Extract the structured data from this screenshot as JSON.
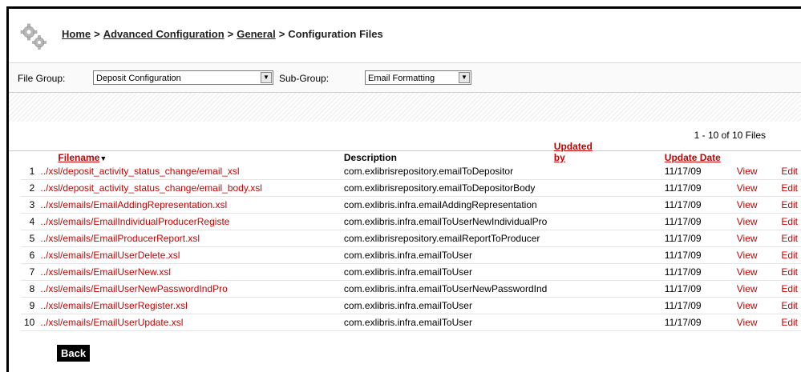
{
  "breadcrumb": {
    "home": "Home",
    "advanced": "Advanced Configuration",
    "general": "General",
    "current": "Configuration Files",
    "separator": ">"
  },
  "filters": {
    "file_group_label": "File Group:",
    "file_group_value": "Deposit Configuration",
    "sub_group_label": "Sub-Group:",
    "sub_group_value": "Email Formatting"
  },
  "results_count": "1 - 10 of 10 Files",
  "table": {
    "columns": {
      "filename": "Filename",
      "description": "Description",
      "updated_by": "Updated by",
      "update_date": "Update Date"
    },
    "rows": [
      {
        "num": "1",
        "filename": "../xsl/deposit_activity_status_change/email_xsl",
        "description": "com.exlibrisrepository.emailToDepositor",
        "date": "11/17/09",
        "view": "View",
        "edit": "Edit"
      },
      {
        "num": "2",
        "filename": "../xsl/deposit_activity_status_change/email_body.xsl",
        "description": "com.exlibrisrepository.emailToDepositorBody",
        "date": "11/17/09",
        "view": "View",
        "edit": "Edit"
      },
      {
        "num": "3",
        "filename": "../xsl/emails/EmailAddingRepresentation.xsl",
        "description": "com.exlibris.infra.emailAddingRepresentation",
        "date": "11/17/09",
        "view": "View",
        "edit": "Edit"
      },
      {
        "num": "4",
        "filename": "../xsl/emails/EmailIndividualProducerRegiste",
        "description": "com.exlibris.infra.emailToUserNewIndividualPro",
        "date": "11/17/09",
        "view": "View",
        "edit": "Edit"
      },
      {
        "num": "5",
        "filename": "../xsl/emails/EmailProducerReport.xsl",
        "description": "com.exlibrisrepository.emailReportToProducer",
        "date": "11/17/09",
        "view": "View",
        "edit": "Edit"
      },
      {
        "num": "6",
        "filename": "../xsl/emails/EmailUserDelete.xsl",
        "description": "com.exlibris.infra.emailToUser",
        "date": "11/17/09",
        "view": "View",
        "edit": "Edit"
      },
      {
        "num": "7",
        "filename": "../xsl/emails/EmailUserNew.xsl",
        "description": "com.exlibris.infra.emailToUser",
        "date": "11/17/09",
        "view": "View",
        "edit": "Edit"
      },
      {
        "num": "8",
        "filename": "../xsl/emails/EmailUserNewPasswordIndPro",
        "description": "com.exlibris.infra.emailToUserNewPasswordInd",
        "date": "11/17/09",
        "view": "View",
        "edit": "Edit"
      },
      {
        "num": "9",
        "filename": "../xsl/emails/EmailUserRegister.xsl",
        "description": "com.exlibris.infra.emailToUser",
        "date": "11/17/09",
        "view": "View",
        "edit": "Edit"
      },
      {
        "num": "10",
        "filename": "../xsl/emails/EmailUserUpdate.xsl",
        "description": "com.exlibris.infra.emailToUser",
        "date": "11/17/09",
        "view": "View",
        "edit": "Edit"
      }
    ]
  },
  "back_label": "Back",
  "icons": {
    "header": "gears-icon",
    "sort": "sort-down-icon",
    "dropdown": "dropdown-arrow-icon"
  },
  "colors": {
    "link_red": "#cc0000"
  }
}
